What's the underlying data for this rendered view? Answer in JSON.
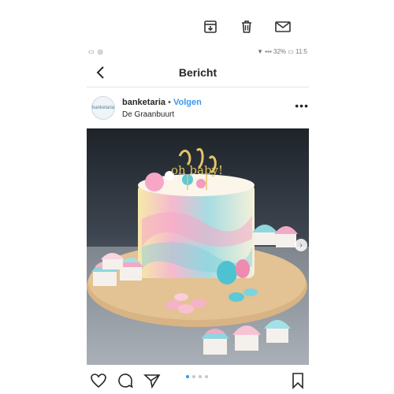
{
  "toolbar": {
    "top_cut_text": "᷈ ᷈ ᷈ ᷈ ᷈",
    "icons": [
      "archive-icon",
      "trash-icon",
      "mail-icon"
    ]
  },
  "status_bar": {
    "left": "▭ ◎",
    "right": "▼ ▪▪▪ 32% ▭ 11:5"
  },
  "nav": {
    "title": "Bericht"
  },
  "post": {
    "avatar_text": "banketaria",
    "username": "banketaria",
    "separator": " • ",
    "follow_label": "Volgen",
    "location": "De Graanbuurt",
    "more_label": "•••",
    "topper_text": "oh baby!",
    "carousel_total": 4,
    "carousel_active": 0
  },
  "colors": {
    "accent": "#3897f0",
    "cake_pink": "#f2a9c4",
    "cake_blue": "#58c8d6",
    "board": "#d8b384"
  }
}
